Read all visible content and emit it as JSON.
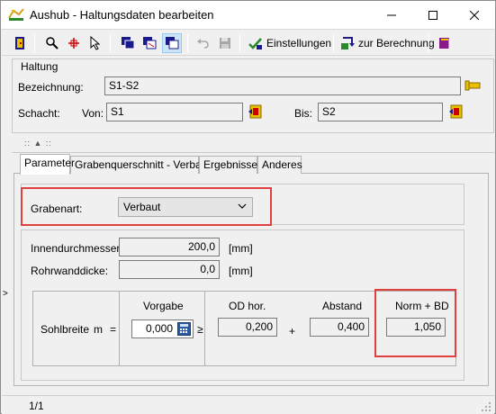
{
  "window": {
    "title": "Aushub - Haltungsdaten bearbeiten"
  },
  "toolbar": {
    "settings_label": "Einstellungen",
    "calc_label": "zur Berechnung"
  },
  "haltung": {
    "group_label": "Haltung",
    "bezeichnung_label": "Bezeichnung:",
    "bezeichnung_value": "S1-S2",
    "schacht_label": "Schacht:",
    "von_label": "Von:",
    "von_value": "S1",
    "bis_label": "Bis:",
    "bis_value": "S2"
  },
  "tabs": [
    {
      "label": "Parameter"
    },
    {
      "label": "Grabenquerschnitt - Verbaut"
    },
    {
      "label": "Ergebnisse"
    },
    {
      "label": "Anderes"
    }
  ],
  "parameter": {
    "grabenart_label": "Grabenart:",
    "grabenart_value": "Verbaut",
    "innendurchmesser_label": "Innendurchmesser:",
    "innendurchmesser_value": "200,0",
    "innendurchmesser_unit": "[mm]",
    "rohrwanddicke_label": "Rohrwanddicke:",
    "rohrwanddicke_value": "0,0",
    "rohrwanddicke_unit": "[mm]",
    "sohlbreite_label": "Sohlbreite",
    "m_label": "m",
    "eq_sign": "=",
    "vorgabe_header": "Vorgabe",
    "vorgabe_value": "0,000",
    "geq_sign": "≥",
    "od_header": "OD hor.",
    "od_value": "0,200",
    "plus_sign": "+",
    "abstand_header": "Abstand",
    "abstand_value": "0,400",
    "norm_header": "Norm + BD",
    "norm_value": "1,050"
  },
  "status": {
    "record": "1/1"
  },
  "colors": {
    "highlight": "#e0413e",
    "accent_blue": "#2c5aa0"
  }
}
